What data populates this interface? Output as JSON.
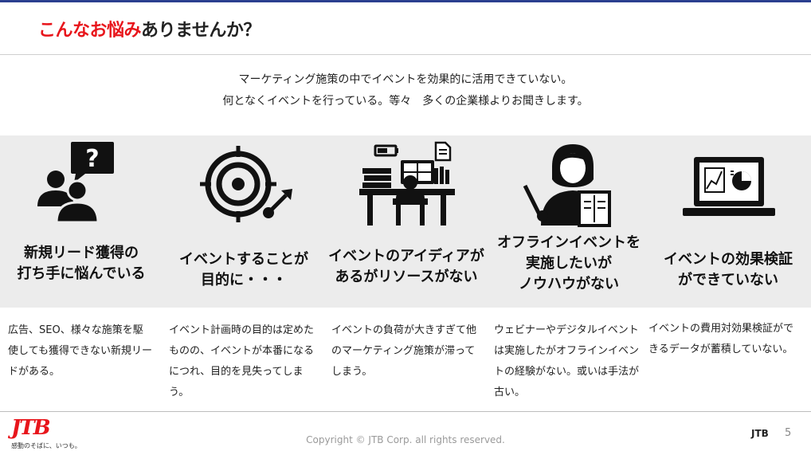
{
  "header": {
    "title_highlight": "こんなお悩み",
    "title_rest": "ありませんか？"
  },
  "intro": {
    "line1": "マーケティング施策の中でイベントを効果的に活用できていない。",
    "line2": "何となくイベントを行っている。等々　多くの企業様よりお聞きします。"
  },
  "concerns": [
    {
      "icon": "people-question-icon",
      "heading_lines": [
        "新規リード獲得の",
        "打ち手に悩んでいる"
      ],
      "description": "広告、SEO、様々な施策を駆使しても獲得できない新規リードがある。"
    },
    {
      "icon": "target-dart-icon",
      "heading_lines": [
        "イベントすることが",
        "目的に・・・"
      ],
      "description": "イベント計画時の目的は定めたものの、イベントが本番になるにつれ、目的を見失ってしまう。"
    },
    {
      "icon": "overloaded-desk-icon",
      "heading_lines": [
        "イベントのアイディアが",
        "あるがリソースがない"
      ],
      "description": "イベントの負荷が大きすぎて他のマーケティング施策が滞ってしまう。"
    },
    {
      "icon": "lecturer-icon",
      "heading_lines": [
        "オフラインイベントを",
        "実施したいが",
        "ノウハウがない"
      ],
      "description": "ウェビナーやデジタルイベントは実施したがオフラインイベントの経験がない。或いは手法が古い。"
    },
    {
      "icon": "laptop-chart-icon",
      "heading_lines": [
        "イベントの効果検証",
        "ができていない"
      ],
      "description": "イベントの費用対効果検証ができるデータが蓄積していない。"
    }
  ],
  "footer": {
    "logo_text": "JTB",
    "logo_tagline": "感動のそばに、いつも。",
    "copyright": "Copyright © JTB Corp. all rights reserved.",
    "brand": "JTB",
    "page_number": "5"
  },
  "colors": {
    "accent_red": "#e8151b",
    "band_gray": "#ececec",
    "top_line": "#2b3f8f"
  }
}
